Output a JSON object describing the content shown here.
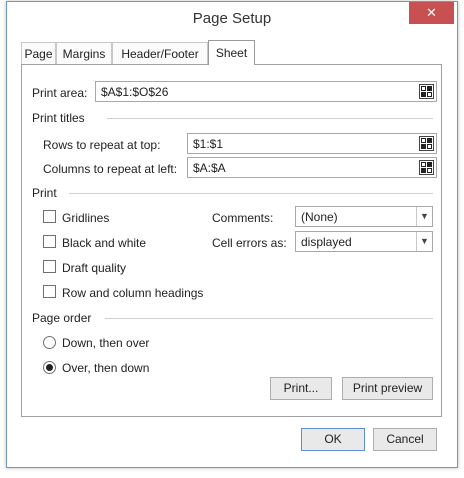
{
  "dialog": {
    "title": "Page Setup",
    "close_glyph": "✕"
  },
  "tabs": [
    {
      "label": "Page"
    },
    {
      "label": "Margins"
    },
    {
      "label": "Header/Footer"
    },
    {
      "label": "Sheet",
      "active": true
    }
  ],
  "sheet": {
    "print_area": {
      "label": "Print area:",
      "value": "$A$1:$O$26"
    },
    "print_titles": {
      "heading": "Print titles",
      "rows": {
        "label": "Rows to repeat at top:",
        "value": "$1:$1"
      },
      "columns": {
        "label": "Columns to repeat at left:",
        "value": "$A:$A"
      }
    },
    "print": {
      "heading": "Print",
      "gridlines": {
        "label": "Gridlines",
        "checked": false
      },
      "black_white": {
        "label": "Black and white",
        "checked": false
      },
      "draft": {
        "label": "Draft quality",
        "checked": false
      },
      "headings": {
        "label": "Row and column headings",
        "checked": false
      },
      "comments": {
        "label": "Comments:",
        "value": "(None)"
      },
      "cell_errors": {
        "label": "Cell errors as:",
        "value": "displayed"
      }
    },
    "page_order": {
      "heading": "Page order",
      "down_over": {
        "label": "Down, then over",
        "selected": false
      },
      "over_down": {
        "label": "Over, then down",
        "selected": true
      }
    },
    "print_button": "Print...",
    "preview_button": "Print preview"
  },
  "footer": {
    "ok": "OK",
    "cancel": "Cancel"
  },
  "colors": {
    "accent_border": "#6f97c8",
    "close": "#c75050"
  }
}
